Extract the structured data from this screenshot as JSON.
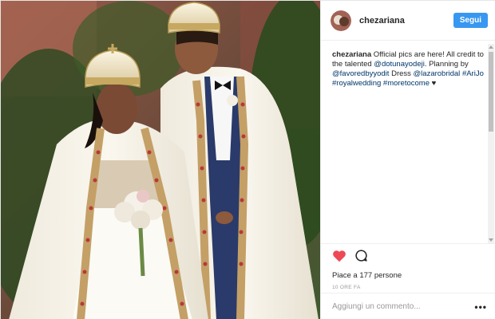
{
  "post": {
    "username": "chezariana",
    "follow_label": "Segui",
    "caption": {
      "user": "chezariana",
      "text_1": " Official pics are here! All credit to the talented ",
      "mention_1": "@dotunayodeji",
      "text_2": ". Planning by ",
      "mention_2": "@favoredbyyodit",
      "text_3": " Dress ",
      "mention_3": "@lazarobridal",
      "text_4": " ",
      "hashtag_1": "#AriJo",
      "text_5": " ",
      "hashtag_2": "#royalwedding",
      "text_6": " ",
      "hashtag_3": "#moretocome",
      "text_7": " ♥"
    },
    "likes": "Piace a 177 persone",
    "time_ago": "10 ORE FA",
    "comment_placeholder": "Aggiungi un commento...",
    "more_label": "•••"
  },
  "icons": {
    "like": "heart-icon",
    "comment": "comment-icon",
    "more": "more-options-icon"
  },
  "colors": {
    "accent": "#3897f0",
    "like": "#ed4956",
    "link": "#003569"
  }
}
